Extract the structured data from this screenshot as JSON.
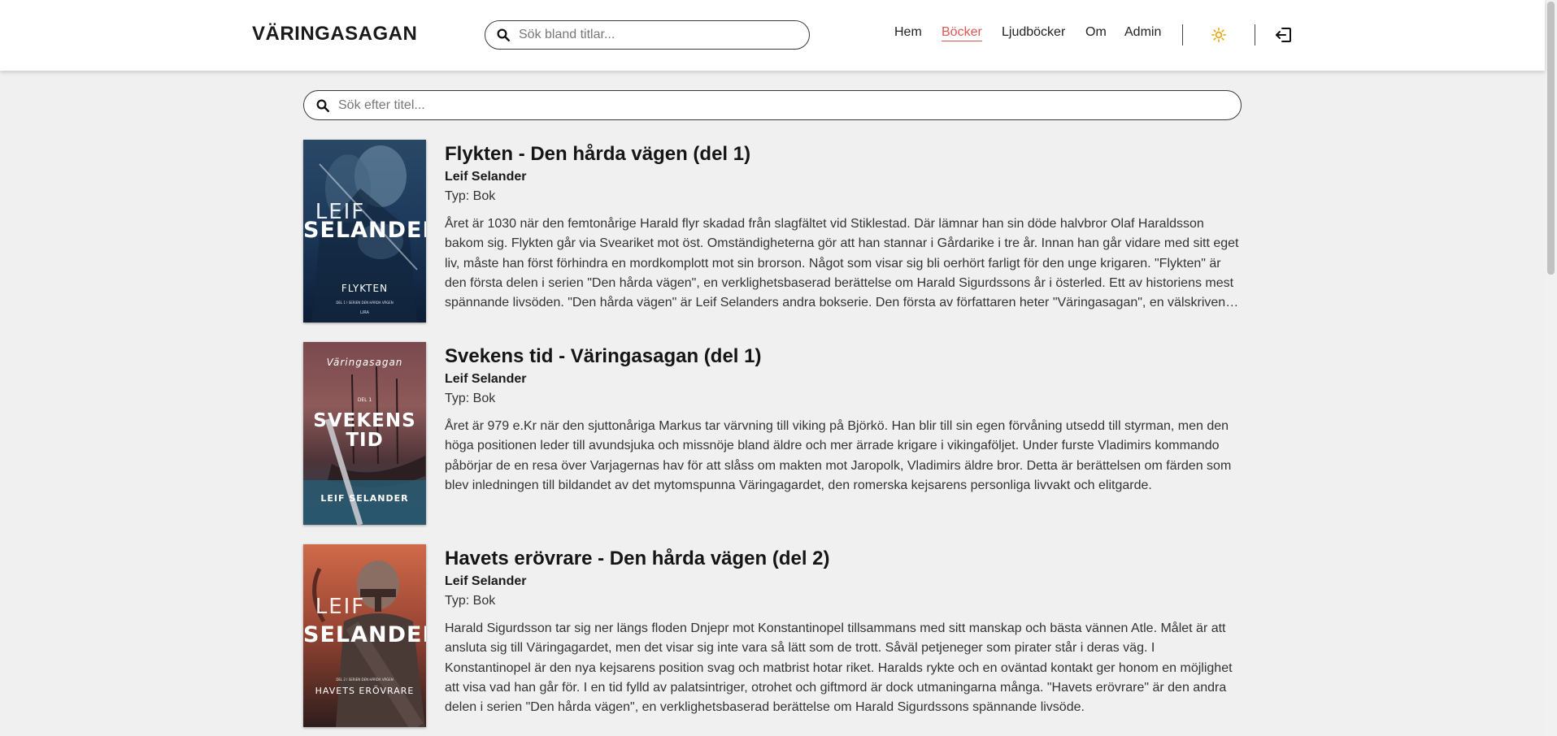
{
  "header": {
    "brand": "VÄRINGASAGAN",
    "search_placeholder": "Sök bland titlar...",
    "nav": [
      {
        "label": "Hem",
        "active": false
      },
      {
        "label": "Böcker",
        "active": true
      },
      {
        "label": "Ljudböcker",
        "active": false
      },
      {
        "label": "Om",
        "active": false
      },
      {
        "label": "Admin",
        "active": false
      }
    ],
    "theme_icon": "sun-icon",
    "logout_icon": "logout-icon",
    "active_color": "#e05555"
  },
  "main": {
    "search_placeholder": "Sök efter titel...",
    "books": [
      {
        "title": "Flykten - Den hårda vägen (del 1)",
        "author": "Leif Selander",
        "type": "Typ: Bok",
        "description": "Året är 1030 när den femtonårige Harald flyr skadad från slagfältet vid Stiklestad. Där lämnar han sin döde halvbror Olaf Haraldsson bakom sig. Flykten går via Sveariket mot öst. Omständigheterna gör att han stannar i Gårdarike i tre år. Innan han går vidare med sitt eget liv, måste han först förhindra en mordkomplott mot sin brorson. Något som visar sig bli oerhört farligt för den unge krigaren. \"Flykten\" är den första delen i serien \"Den hårda vägen\", en verklighetsbaserad berättelse om Harald Sigurdssons år i österled. Ett av historiens mest spännande livsöden. \"Den hårda vägen\" är Leif Selanders andra bokserie. Den första av författaren heter \"Väringasagan\", en välskriven berättelse.",
        "cover": {
          "top": "LEIF",
          "middle": "SELANDER",
          "small": "DEL 1 I SERIEN DEN HÅRDA VÄGEN",
          "bottom": "FLYKTEN",
          "publisher": "LIRA"
        }
      },
      {
        "title": "Svekens tid - Väringasagan (del 1)",
        "author": "Leif Selander",
        "type": "Typ: Bok",
        "description": "Året är 979 e.Kr när den sjuttonåriga Markus tar värvning till viking på Björkö. Han blir till sin egen förvåning utsedd till styrman, men den höga positionen leder till avundsjuka och missnöje bland äldre och mer ärrade krigare i vikingaföljet. Under furste Vladimirs kommando påbörjar de en resa över Varjagernas hav för att slåss om makten mot Jaropolk, Vladimirs äldre bror. Detta är berättelsen om färden som blev inledningen till bildandet av det mytomspunna Väringagardet, den romerska kejsarens personliga livvakt och elitgarde.",
        "cover": {
          "top": "Väringasagan",
          "small": "DEL 1",
          "middle1": "SVEKENS",
          "middle2": "TID",
          "bottom": "LEIF SELANDER"
        }
      },
      {
        "title": "Havets erövrare - Den hårda vägen (del 2)",
        "author": "Leif Selander",
        "type": "Typ: Bok",
        "description": "Harald Sigurdsson tar sig ner längs floden Dnjepr mot Konstantinopel tillsammans med sitt manskap och bästa vännen Atle. Målet är att ansluta sig till Väringagardet, men det visar sig inte vara så lätt som de trott. Såväl petjeneger som pirater står i deras väg. I Konstantinopel är den nya kejsarens position svag och matbrist hotar riket. Haralds rykte och en oväntad kontakt ger honom en möjlighet att visa vad han går för. I en tid fylld av palatsintriger, otrohet och giftmord är dock utmaningarna många. \"Havets erövrare\" är den andra delen i serien \"Den hårda vägen\", en verklighetsbaserad berättelse om Harald Sigurdssons spännande livsöde.",
        "cover": {
          "top": "LEIF",
          "middle": "SELANDER",
          "small": "DEL 2 I SERIEN DEN HÅRDA VÄGEN",
          "bottom": "HAVETS ERÖVRARE"
        }
      }
    ]
  }
}
